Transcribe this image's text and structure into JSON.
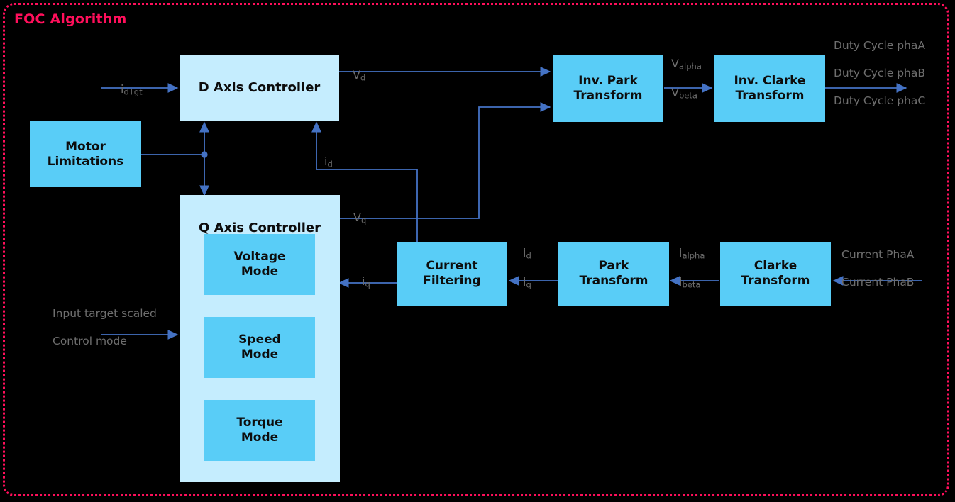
{
  "diagram": {
    "title": "FOC Algorithm",
    "frame_color": "#FF0F5B",
    "background": "#000000",
    "wire_color": "#4472C4",
    "label_color": "#6E6E6E",
    "block_fill_pale": "#C5EDFE",
    "block_fill_bright": "#59CDF7"
  },
  "blocks": {
    "d_axis": {
      "label": "D Axis Controller"
    },
    "motor_limitations": {
      "label": "Motor\nLimitations"
    },
    "q_axis": {
      "label": "Q Axis Controller"
    },
    "voltage_mode": {
      "label": "Voltage\nMode"
    },
    "speed_mode": {
      "label": "Speed\nMode"
    },
    "torque_mode": {
      "label": "Torque\nMode"
    },
    "current_filtering": {
      "label": "Current\nFiltering"
    },
    "park_transform": {
      "label": "Park\nTransform"
    },
    "clarke_transform": {
      "label": "Clarke\nTransform"
    },
    "inv_park_transform": {
      "label": "Inv. Park\nTransform"
    },
    "inv_clarke_transform": {
      "label": "Inv. Clarke\nTransform"
    }
  },
  "signals": {
    "i_d_tgt": {
      "base": "i",
      "sub": "dTgt"
    },
    "v_d": {
      "base": "V",
      "sub": "d"
    },
    "v_q": {
      "base": "V",
      "sub": "q"
    },
    "i_d_feedback": {
      "base": "i",
      "sub": "d"
    },
    "i_q_feedback": {
      "base": "i",
      "sub": "q"
    },
    "i_dq_bus_1": {
      "base": "i",
      "sub": "d"
    },
    "i_dq_bus_2": {
      "base": "i",
      "sub": "q"
    },
    "i_alpha": {
      "base": "i",
      "sub": "alpha"
    },
    "i_beta": {
      "base": "i",
      "sub": "beta"
    },
    "v_alpha": {
      "base": "V",
      "sub": "alpha"
    },
    "v_beta": {
      "base": "V",
      "sub": "beta"
    },
    "control_inputs": {
      "line1": "Input target scaled",
      "line2": "Control mode"
    },
    "duty_cycles": {
      "line1": "Duty Cycle phaA",
      "line2": "Duty Cycle phaB",
      "line3": "Duty Cycle phaC"
    },
    "current_phases": {
      "line1": "Current PhaA",
      "line2": "Current PhaB"
    }
  }
}
